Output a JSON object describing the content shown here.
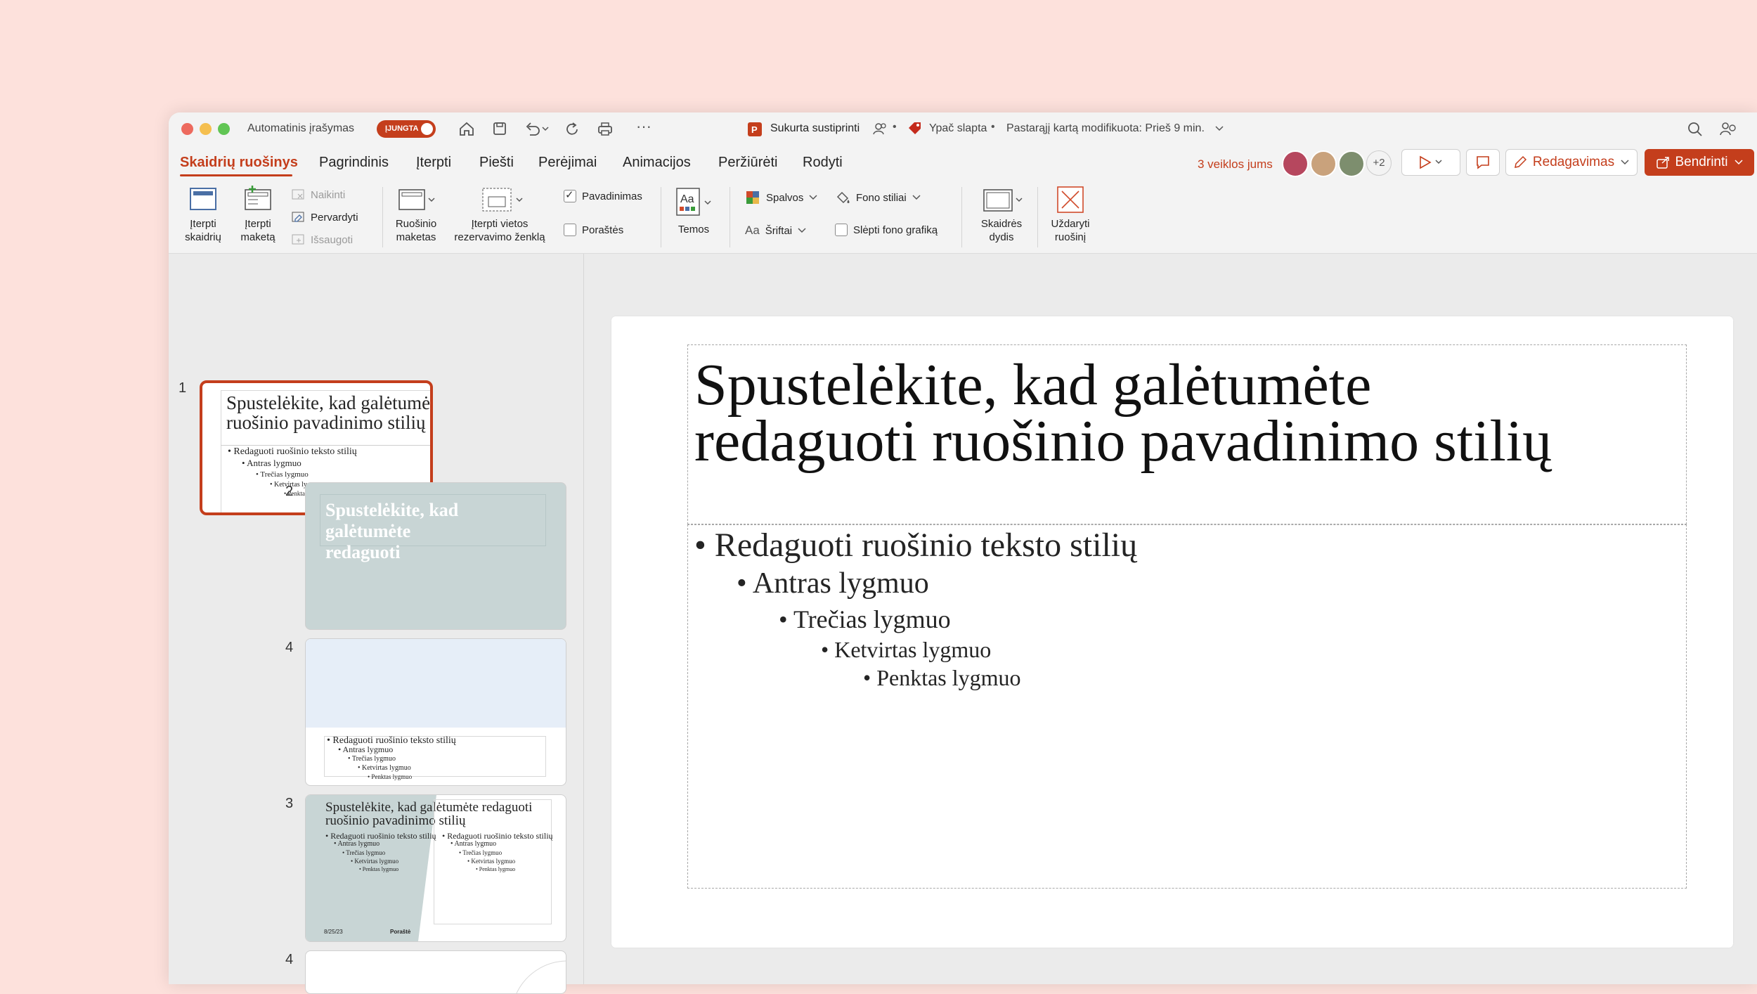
{
  "titlebar": {
    "autosave_label": "Automatinis įrašymas",
    "autosave_state": "ĮJUNGTA",
    "doc_name": "Sukurta sustiprinti",
    "sensitivity": "Ypač slapta",
    "modified": "Pastarąjį kartą modifikuota: Prieš 9 min."
  },
  "tabs": [
    "Skaidrių ruošinys",
    "Pagrindinis",
    "Įterpti",
    "Piešti",
    "Perėjimai",
    "Animacijos",
    "Peržiūrėti",
    "Rodyti"
  ],
  "topright": {
    "activity": "3 veiklos jums",
    "more_count": "+2",
    "editing": "Redagavimas",
    "share": "Bendrinti"
  },
  "ribbon": {
    "insert_slide": "Įterpti skaidrių",
    "insert_layout": "Įterpti maketą",
    "delete": "Naikinti",
    "rename": "Pervardyti",
    "preserve": "Išsaugoti",
    "master_layout": "Ruošinio maketas",
    "insert_placeholder": "Įterpti vietos rezervavimo ženklą",
    "title_check": "Pavadinimas",
    "footers_check": "Poraštės",
    "themes": "Temos",
    "colors": "Spalvos",
    "fonts": "Šriftai",
    "background_styles": "Fono stiliai",
    "hide_background": "Slėpti fono grafiką",
    "slide_size": "Skaidrės dydis",
    "close_master": "Uždaryti ruošinį"
  },
  "thumbnails": {
    "t1": {
      "number": "1",
      "title": "Spustelėkite, kad galėtumėte redaguoti ruošinio pavadinimo stilių",
      "bullets": [
        "• Redaguoti ruošinio teksto stilių",
        "• Antras lygmuo",
        "• Trečias lygmuo",
        "• Ketvirtas lygmuo",
        "• Penktas lygmuo"
      ]
    },
    "t2": {
      "number": "2",
      "title": "Spustelėkite, kad galėtumėte redaguoti"
    },
    "t3": {
      "number": "4",
      "bullets": [
        "• Redaguoti ruošinio teksto stilių",
        "• Antras lygmuo",
        "• Trečias lygmuo",
        "• Ketvirtas lygmuo",
        "• Penktas lygmuo"
      ]
    },
    "t4": {
      "number": "3",
      "title": "Spustelėkite, kad galėtumėte redaguoti ruošinio pavadinimo stilių",
      "left_bullets": [
        "• Redaguoti ruošinio teksto stilių",
        "• Antras lygmuo",
        "• Trečias lygmuo",
        "• Ketvirtas lygmuo",
        "• Penktas lygmuo"
      ],
      "right_bullets": [
        "• Redaguoti ruošinio teksto stilių",
        "• Antras lygmuo",
        "• Trečias lygmuo",
        "• Ketvirtas lygmuo",
        "• Penktas lygmuo"
      ],
      "footer_date": "8/25/23",
      "footer_text": "Poraštė"
    },
    "t5": {
      "number": "4"
    }
  },
  "slide": {
    "title_line1": "Spustelėkite, kad galėtumėte",
    "title_line2": "redaguoti ruošinio pavadinimo stilių",
    "bullets": [
      "• Redaguoti ruošinio teksto stilių",
      "• Antras lygmuo",
      "• Trečias lygmuo",
      "• Ketvirtas lygmuo",
      "• Penktas lygmuo"
    ]
  },
  "colors": {
    "accent": "#c43e1c",
    "thumb_gray": "#c8d5d5",
    "thumb_blue": "#e6eef8"
  }
}
